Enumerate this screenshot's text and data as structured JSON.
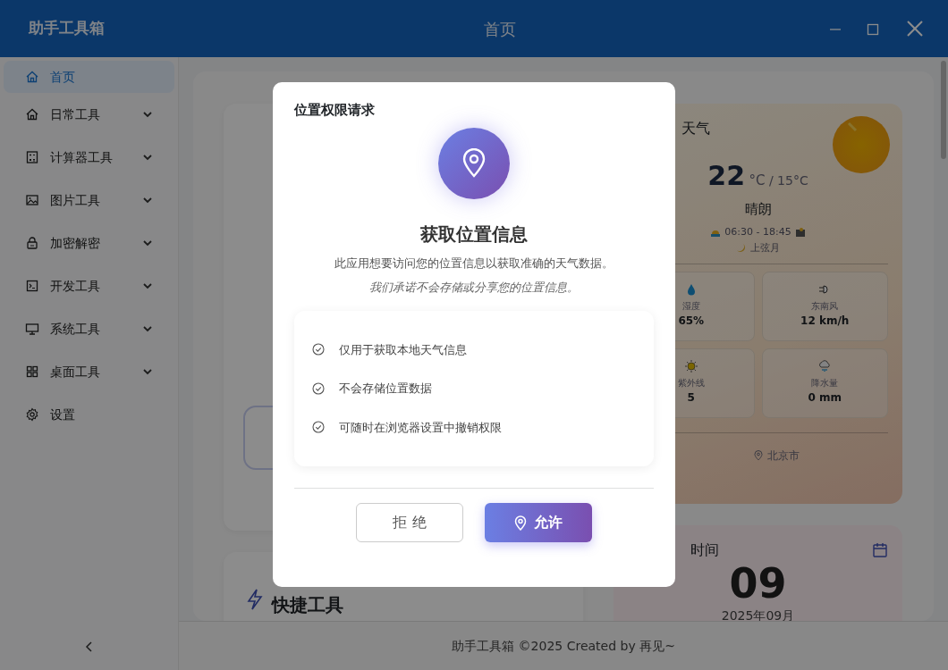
{
  "app": {
    "title": "助手工具箱",
    "page_title": "首页"
  },
  "sidebar": {
    "items": [
      {
        "label": "首页",
        "kind": "home",
        "selected": true,
        "expandable": false
      },
      {
        "label": "日常工具",
        "kind": "home",
        "selected": false,
        "expandable": true
      },
      {
        "label": "计算器工具",
        "kind": "calculator",
        "selected": false,
        "expandable": true
      },
      {
        "label": "图片工具",
        "kind": "image",
        "selected": false,
        "expandable": true
      },
      {
        "label": "加密解密",
        "kind": "lock",
        "selected": false,
        "expandable": true
      },
      {
        "label": "开发工具",
        "kind": "terminal",
        "selected": false,
        "expandable": true
      },
      {
        "label": "系统工具",
        "kind": "monitor",
        "selected": false,
        "expandable": true
      },
      {
        "label": "桌面工具",
        "kind": "grid",
        "selected": false,
        "expandable": true
      },
      {
        "label": "设置",
        "kind": "gear",
        "selected": false,
        "expandable": false
      }
    ]
  },
  "weather": {
    "title": "天气",
    "temperature": "22",
    "unit": "°C",
    "low": "/ 15°C",
    "condition": "晴朗",
    "sun_times": "06:30 - 18:45",
    "moon_phase": "上弦月",
    "stats": [
      {
        "kind": "humidity",
        "label": "湿度",
        "value": "65%"
      },
      {
        "kind": "wind",
        "label": "东南风",
        "value": "12 km/h"
      },
      {
        "kind": "uv",
        "label": "紫外线",
        "value": "5"
      },
      {
        "kind": "rain",
        "label": "降水量",
        "value": "0 mm"
      }
    ],
    "location": "北京市"
  },
  "time_card": {
    "title": "时间",
    "day": "09",
    "month": "2025年09月"
  },
  "quick_tools": {
    "title": "快捷工具"
  },
  "footer": "助手工具箱 ©2025 Created by 再见~",
  "dialog": {
    "title": "位置权限请求",
    "heading": "获取位置信息",
    "description": "此应用想要访问您的位置信息以获取准确的天气数据。",
    "note": "我们承诺不会存储或分享您的位置信息。",
    "points": [
      "仅用于获取本地天气信息",
      "不会存储位置数据",
      "可随时在浏览器设置中撤销权限"
    ],
    "deny_button": "拒 绝",
    "allow_button": "允许"
  }
}
